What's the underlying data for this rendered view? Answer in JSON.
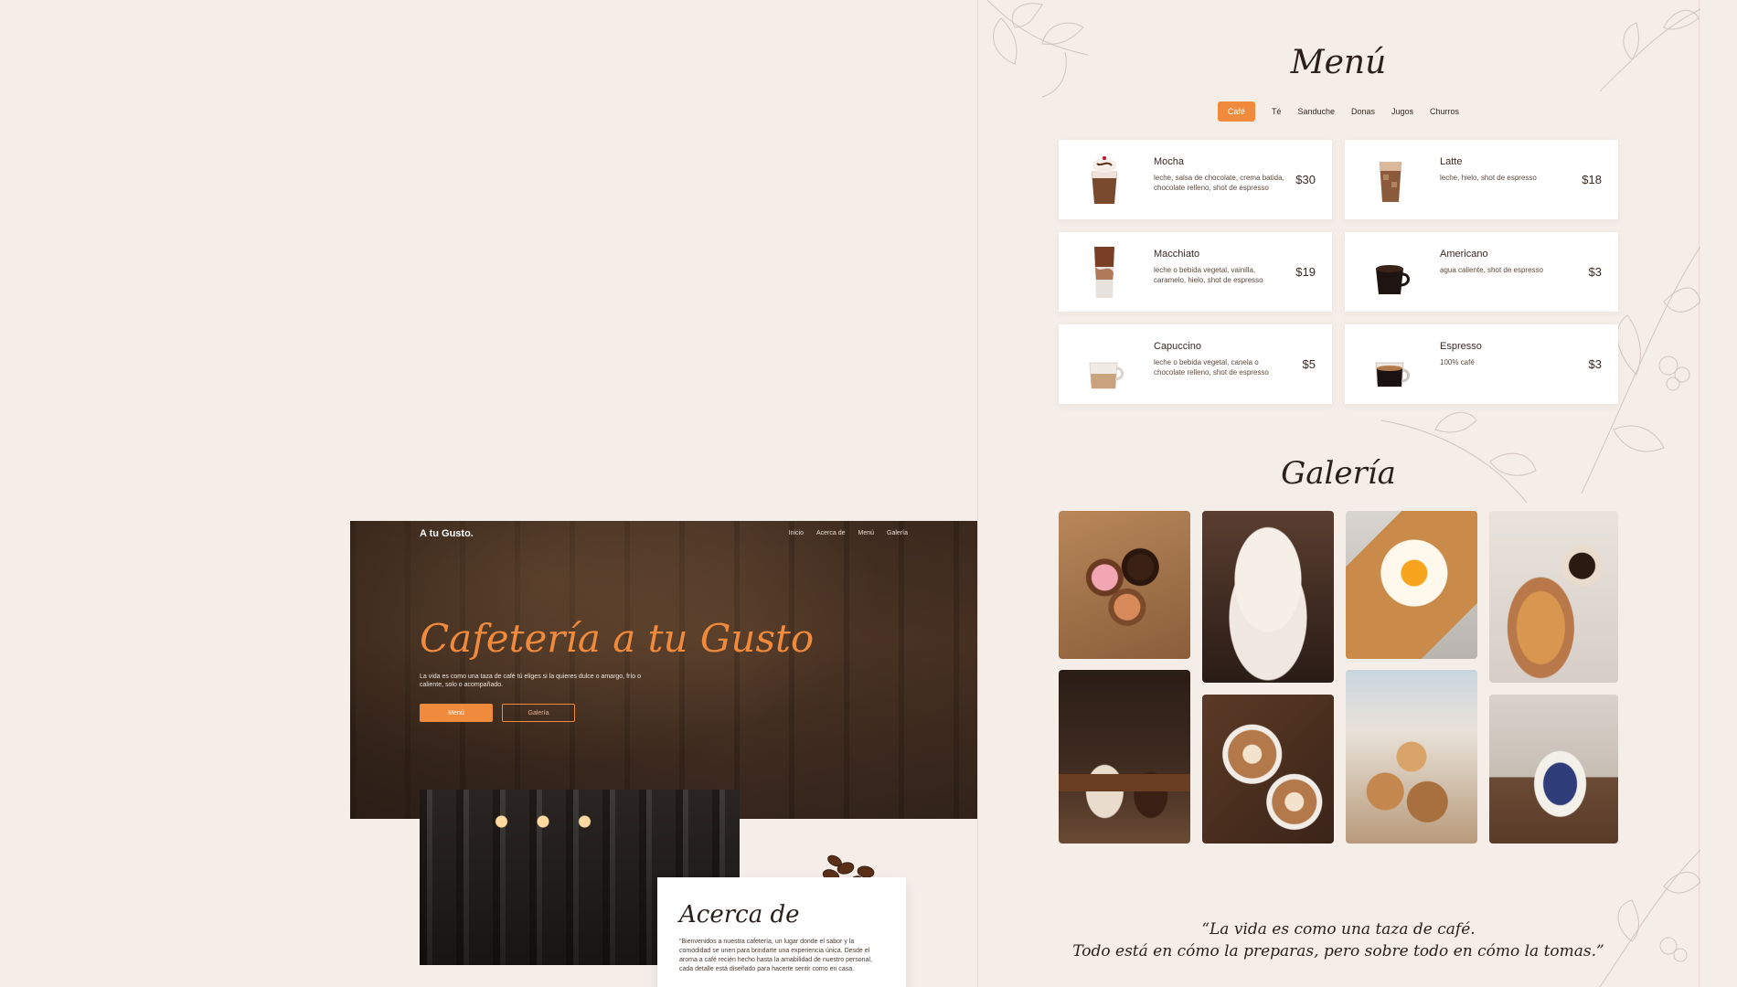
{
  "hero": {
    "brand": "A tu Gusto.",
    "nav": [
      "Inicio",
      "Acerca de",
      "Menú",
      "Galería"
    ],
    "title": "Cafetería a tu Gusto",
    "text": "La vida es como una taza de café tú eliges si la quieres dulce o amargo, frío o caliente, solo o acompañado.",
    "primary_button": "Menú",
    "secondary_button": "Galería"
  },
  "about": {
    "title": "Acerca de",
    "text": "\"Bienvenidos a nuestra cafetería, un lugar donde el sabor y la comodidad se unen para brindarte una experiencia única. Desde el aroma a café recién hecho hasta la amabilidad de nuestro personal, cada detalle está diseñado para hacerte sentir como en casa."
  },
  "menu": {
    "title": "Menú",
    "tabs": [
      "Café",
      "Té",
      "Sanduche",
      "Donas",
      "Jugos",
      "Churros"
    ],
    "active_tab": "Café",
    "items": [
      {
        "name": "Mocha",
        "desc": "leche, salsa de chocolate, crema batida, chocolate relleno, shot de espresso",
        "price": "$30",
        "icon": "mocha-cup-icon"
      },
      {
        "name": "Latte",
        "desc": "leche, hielo, shot de espresso",
        "price": "$18",
        "icon": "latte-glass-icon"
      },
      {
        "name": "Macchiato",
        "desc": "leche o bebida vegetal, vainilla, caramelo, hielo, shot de espresso",
        "price": "$19",
        "icon": "macchiato-glass-icon"
      },
      {
        "name": "Americano",
        "desc": "agua caliente, shot de espresso",
        "price": "$3",
        "icon": "americano-cup-icon"
      },
      {
        "name": "Capuccino",
        "desc": "leche o bebida vegetal, canela o chocolate relleno, shot de espresso",
        "price": "$5",
        "icon": "cappuccino-cup-icon"
      },
      {
        "name": "Espresso",
        "desc": "100% café",
        "price": "$3",
        "icon": "espresso-cup-icon"
      }
    ]
  },
  "gallery": {
    "title": "Galería",
    "images": [
      "donuts-photo",
      "mocha-photo",
      "toast-egg-photo",
      "croissant-coffee-photo",
      "pour-latte-photo",
      "latte-art-photo",
      "pastries-photo",
      "teacup-photo"
    ]
  },
  "quote": {
    "line1": "“La vida es como una taza de café.",
    "line2": "Todo está en cómo la preparas, pero sobre todo en cómo la tomas.”"
  },
  "colors": {
    "accent": "#f08a3c",
    "background": "#f4ede8",
    "text": "#3a2a22"
  }
}
